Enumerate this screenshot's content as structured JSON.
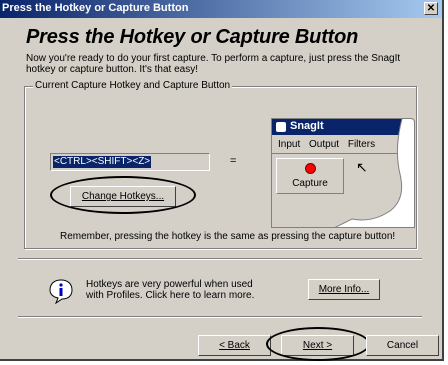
{
  "window": {
    "title": "Press the Hotkey or Capture Button",
    "close_glyph": "✕"
  },
  "page": {
    "heading": "Press the Hotkey or Capture Button",
    "intro": "Now you're ready to do your first capture.  To perform a capture, just press the SnagIt hotkey or capture button.  It's that easy!"
  },
  "group": {
    "label": "Current Capture Hotkey and Capture Button",
    "hotkey_value": "<CTRL><SHIFT><Z>",
    "equals": "=",
    "change_hotkeys_label": "Change Hotkeys...",
    "reminder": "Remember, pressing the hotkey is the same as pressing the capture button!"
  },
  "snagit_preview": {
    "title": "SnagIt",
    "menus": [
      "Input",
      "Output",
      "Filters"
    ],
    "capture_label": "Capture"
  },
  "info": {
    "icon": "info-icon",
    "text": "Hotkeys are very powerful when used with Profiles. Click here to learn more.",
    "more_info_label": "More Info..."
  },
  "footer": {
    "back_label": "< Back",
    "next_label": "Next >",
    "cancel_label": "Cancel"
  },
  "colors": {
    "titlebar": "#0a246a",
    "dialog": "#d4d0c8",
    "capture_dot": "#ff0000"
  }
}
